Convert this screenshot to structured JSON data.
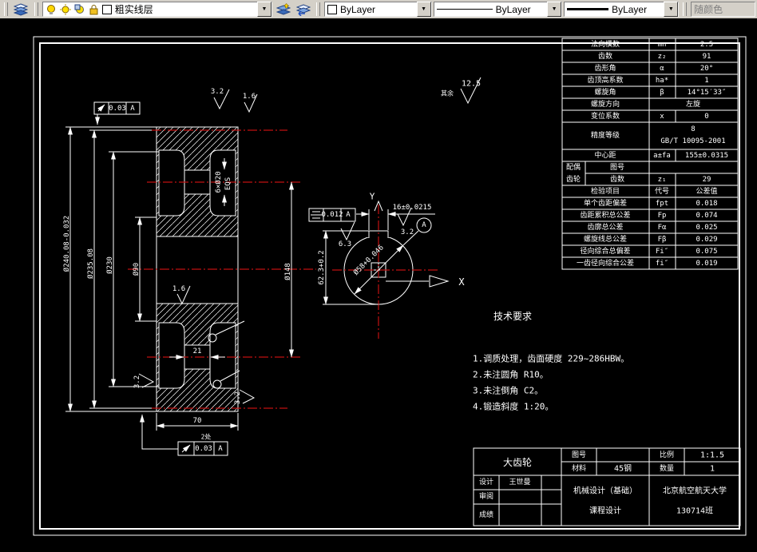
{
  "toolbar": {
    "layer": {
      "name": "粗实线层"
    },
    "color": {
      "value": "ByLayer"
    },
    "linetype": {
      "value": "ByLayer"
    },
    "lineweight": {
      "value": "ByLayer"
    },
    "plotstyle": {
      "value": "随颜色"
    }
  },
  "colors": {
    "centerline": "#c01010",
    "lines": "#ffffff",
    "toolbar_bg": "#d4d0c8"
  },
  "gear_table": {
    "rows": [
      {
        "label": "法向模数",
        "code": "mn",
        "value": "2.5"
      },
      {
        "label": "齿数",
        "code": "z₂",
        "value": "91"
      },
      {
        "label": "齿形角",
        "code": "α",
        "value": "20°"
      },
      {
        "label": "齿顶高系数",
        "code": "ha*",
        "value": "1"
      },
      {
        "label": "螺旋角",
        "code": "β",
        "value": "14°15′33″"
      },
      {
        "label": "螺旋方向",
        "value": "左旋"
      },
      {
        "label": "变位系数",
        "code": "x",
        "value": "0"
      },
      {
        "label": "精度等级",
        "value": "8",
        "value2": "GB/T 10095-2001"
      },
      {
        "label": "中心距",
        "code": "a±fa",
        "value": "155±0.0315"
      },
      {
        "group1": "配偶",
        "group2": "齿轮",
        "label": "图号",
        "value": ""
      },
      {
        "label": "齿数",
        "code": "z₁",
        "value": "29"
      },
      {
        "label": "检验项目",
        "code": "代号",
        "value": "公差值"
      },
      {
        "label": "单个齿距偏差",
        "code": "fpt",
        "value": "0.018"
      },
      {
        "label": "齿距累积总公差",
        "code": "Fp",
        "value": "0.074"
      },
      {
        "label": "齿廓总公差",
        "code": "Fα",
        "value": "0.025"
      },
      {
        "label": "螺旋线总公差",
        "code": "Fβ",
        "value": "0.029"
      },
      {
        "label": "径向综合总偏差",
        "code": "Fi″",
        "value": "0.075"
      },
      {
        "label": "一齿径向综合公差",
        "code": "fi″",
        "value": "0.019"
      }
    ]
  },
  "tech_req": {
    "title": "技术要求",
    "items": [
      "1.调质处理，齿面硬度 229~286HBW。",
      "2.未注圆角 R10。",
      "3.未注倒角 C2。",
      "4.锻造斜度 1:20。"
    ]
  },
  "title_block": {
    "part_name": "大齿轮",
    "drawing_no_label": "图号",
    "drawing_no": "",
    "material_label": "材料",
    "material": "45钢",
    "scale_label": "比例",
    "scale": "1:1.5",
    "qty_label": "数量",
    "qty": "1",
    "design_label": "设计",
    "designer": "王世曼",
    "review_label": "审阅",
    "grade_label": "成绩",
    "course_line1": "机械设计（基础）",
    "course_line2": "课程设计",
    "org_line1": "北京航空航天大学",
    "org_line2": "130714班"
  },
  "dims": {
    "tip_dia": "Ø240.08-0.032",
    "ref_dia": "Ø235.08",
    "rim_inner_dia": "Ø230",
    "hub_dia": "Ø90",
    "bolt_circle": "Ø148",
    "holes": "6×Ø20",
    "holes_note": "EQS",
    "web_thickness": "21",
    "width": "70",
    "bore": "Ø58+0.046",
    "keyway_width": "16±0.0215",
    "keyway_depth": "62.3+0.2",
    "axis_x": "X",
    "axis_y": "Y"
  },
  "gdt": {
    "runout_top": {
      "value": "0.03",
      "datum": "A"
    },
    "runout_bottom": {
      "value": "0.03",
      "datum": "A",
      "note": "2处"
    },
    "symmetry": {
      "value": "0.012",
      "datum": "A"
    },
    "datum_label": "A"
  },
  "roughness": {
    "rest_label": "其余",
    "rest_value": "12.5",
    "top_face": "3.2",
    "top_side": "1.6",
    "bore": "1.6",
    "left_face": "3.2",
    "right_face": "3.2",
    "keyway_side": "3.2",
    "keyway_bottom": "6.3"
  }
}
